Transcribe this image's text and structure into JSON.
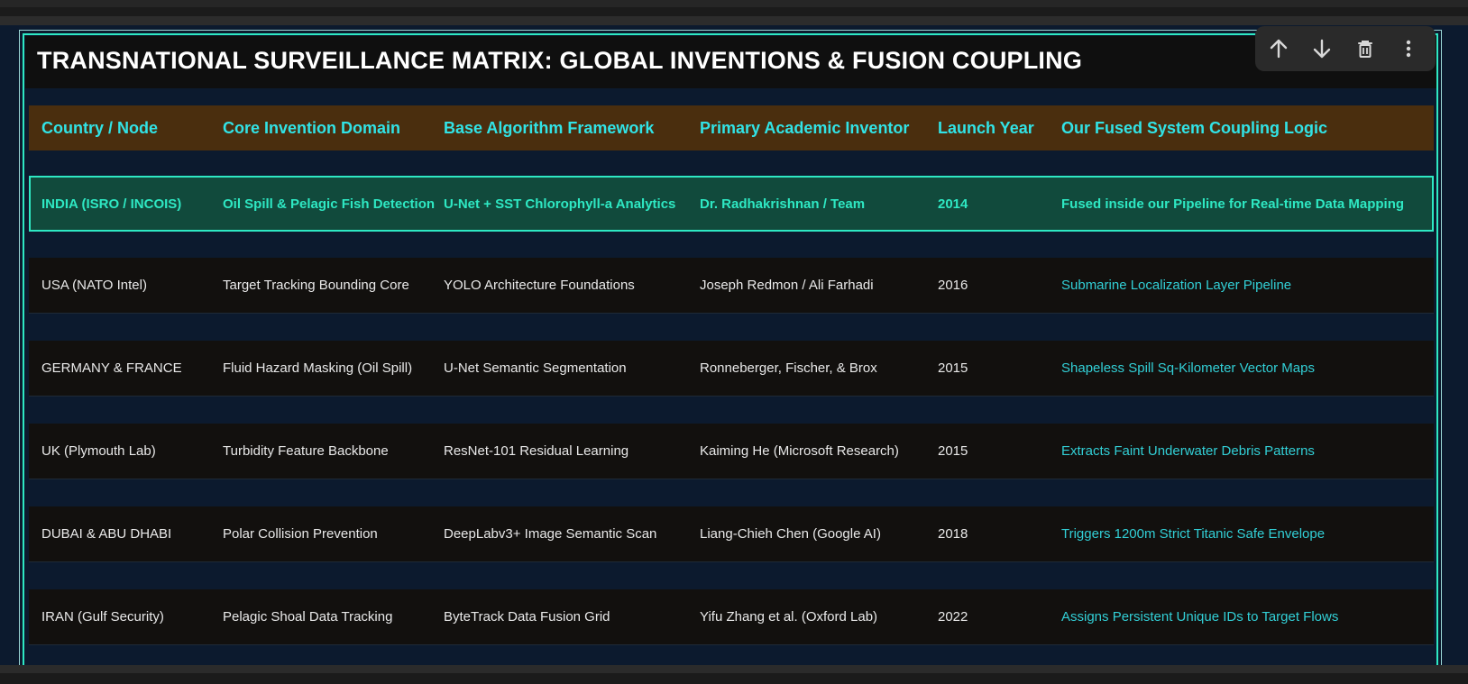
{
  "title": "TRANSNATIONAL SURVEILLANCE MATRIX: GLOBAL INVENTIONS & FUSION COUPLING",
  "toolbar": {
    "move_up": "arrow-up-icon",
    "move_down": "arrow-down-icon",
    "delete": "trash-icon",
    "more": "more-vertical-icon"
  },
  "colors": {
    "header_bg": "#4a2e0e",
    "header_text": "#31e3e6",
    "highlight_bg": "#114a3c",
    "highlight_accent": "#2ee8c3",
    "row_bg": "#12100e",
    "page_bg": "#0c1a2e",
    "logic_text": "#32cfd6"
  },
  "table": {
    "columns": [
      "Country / Node",
      "Core Invention Domain",
      "Base Algorithm Framework",
      "Primary Academic Inventor",
      "Launch Year",
      "Our Fused System Coupling Logic"
    ],
    "rows": [
      [
        "INDIA (ISRO / INCOIS)",
        "Oil Spill & Pelagic Fish Detection",
        "U-Net + SST Chlorophyll-a Analytics",
        "Dr. Radhakrishnan / Team",
        "2014",
        "Fused inside our Pipeline for Real-time Data Mapping"
      ],
      [
        "USA (NATO Intel)",
        "Target Tracking Bounding Core",
        "YOLO Architecture Foundations",
        "Joseph Redmon / Ali Farhadi",
        "2016",
        "Submarine Localization Layer Pipeline"
      ],
      [
        "GERMANY & FRANCE",
        "Fluid Hazard Masking (Oil Spill)",
        "U-Net Semantic Segmentation",
        "Ronneberger, Fischer, & Brox",
        "2015",
        "Shapeless Spill Sq-Kilometer Vector Maps"
      ],
      [
        "UK (Plymouth Lab)",
        "Turbidity Feature Backbone",
        "ResNet-101 Residual Learning",
        "Kaiming He (Microsoft Research)",
        "2015",
        "Extracts Faint Underwater Debris Patterns"
      ],
      [
        "DUBAI & ABU DHABI",
        "Polar Collision Prevention",
        "DeepLabv3+ Image Semantic Scan",
        "Liang-Chieh Chen (Google AI)",
        "2018",
        "Triggers 1200m Strict Titanic Safe Envelope"
      ],
      [
        "IRAN (Gulf Security)",
        "Pelagic Shoal Data Tracking",
        "ByteTrack Data Fusion Grid",
        "Yifu Zhang et al. (Oxford Lab)",
        "2022",
        "Assigns Persistent Unique IDs to Target Flows"
      ]
    ]
  }
}
